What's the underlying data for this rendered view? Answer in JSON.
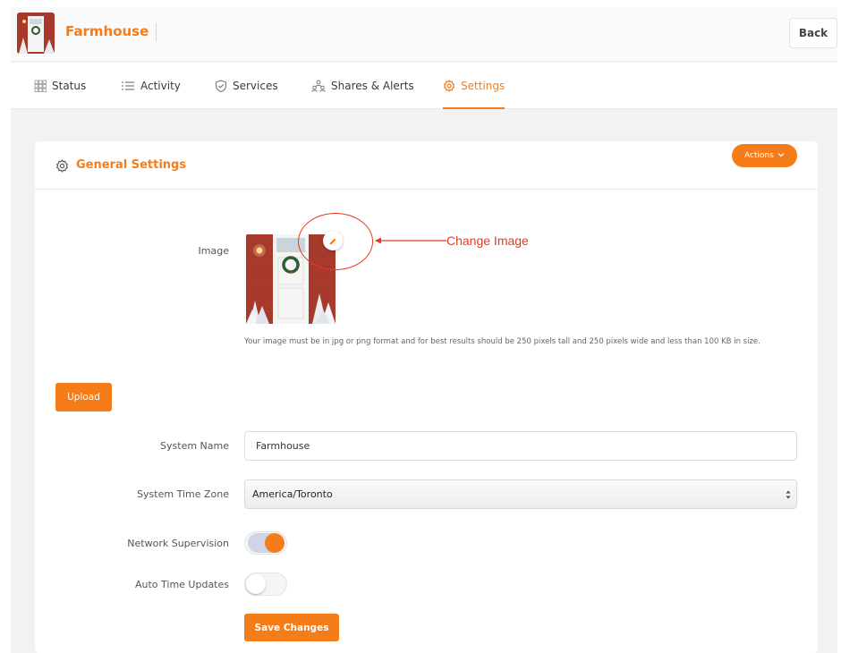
{
  "header": {
    "title": "Farmhouse",
    "back_label": "Back"
  },
  "tabs": [
    {
      "label": "Status",
      "icon": "grid-icon"
    },
    {
      "label": "Activity",
      "icon": "list-icon"
    },
    {
      "label": "Services",
      "icon": "shield-icon"
    },
    {
      "label": "Shares & Alerts",
      "icon": "users-icon"
    },
    {
      "label": "Settings",
      "icon": "gear-icon",
      "active": true
    }
  ],
  "card": {
    "title": "General Settings",
    "actions_label": "Actions"
  },
  "form": {
    "image_label": "Image",
    "help_text": "Your image must be in jpg or png format and for best results should be 250 pixels tall and 250 pixels wide and less than 100 KB in size.",
    "upload_label": "Upload",
    "system_name_label": "System Name",
    "system_name_value": "Farmhouse",
    "time_zone_label": "System Time Zone",
    "time_zone_value": "America/Toronto",
    "network_supervision_label": "Network Supervision",
    "network_supervision_on": true,
    "auto_time_label": "Auto Time Updates",
    "auto_time_on": false,
    "save_label": "Save Changes"
  },
  "annotation": {
    "text": "Change Image"
  },
  "colors": {
    "accent": "#f47d1a",
    "annotation": "#e63a20"
  }
}
